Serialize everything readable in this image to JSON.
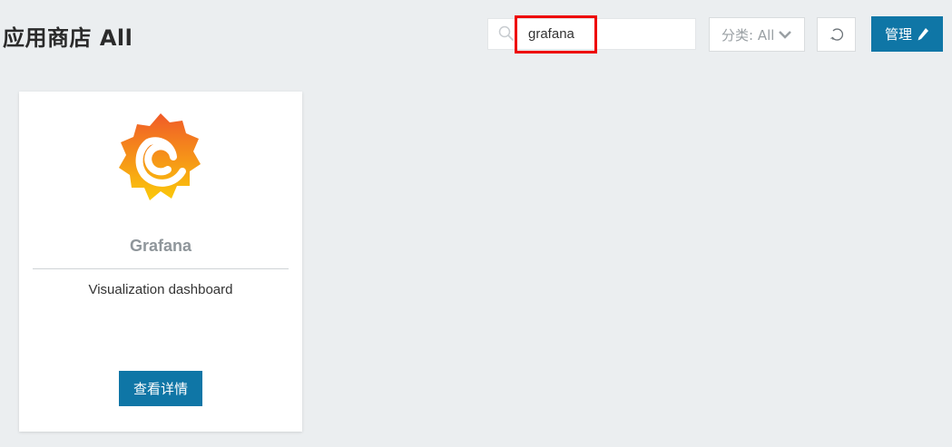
{
  "header": {
    "title": "应用商店 All"
  },
  "search": {
    "value": "grafana",
    "icon": "search-icon"
  },
  "category": {
    "label": "分类: All",
    "icon": "chevron-down-icon"
  },
  "refresh": {
    "icon": "refresh-icon"
  },
  "manage": {
    "label": "管理",
    "icon": "pencil-icon"
  },
  "apps": [
    {
      "name": "Grafana",
      "description": "Visualization dashboard",
      "button_label": "查看详情",
      "logo": "grafana-logo"
    }
  ],
  "colors": {
    "background": "#ebeef0",
    "accent": "#0f76a6",
    "highlight": "#ee0000",
    "logo_gradient_top": "#f05a28",
    "logo_gradient_bottom": "#fbca0a"
  }
}
